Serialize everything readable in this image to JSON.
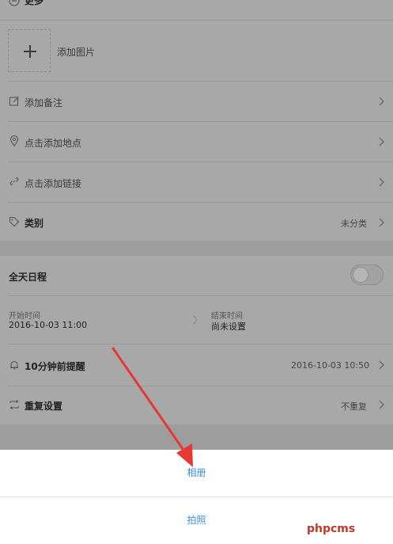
{
  "header": {
    "title": "更多"
  },
  "photo": {
    "label": "添加图片"
  },
  "items": {
    "note": "添加备注",
    "location": "点击添加地点",
    "link": "点击添加链接",
    "category_label": "类别",
    "category_value": "未分类"
  },
  "allday": {
    "label": "全天日程",
    "enabled": false
  },
  "time": {
    "start_label": "开始时间",
    "start_value": "2016-10-03 11:00",
    "end_label": "结束时间",
    "end_value": "尚未设置"
  },
  "reminder": {
    "label": "10分钟前提醒",
    "value": "2016-10-03 10:50"
  },
  "repeat": {
    "label": "重复设置",
    "value": "不重复"
  },
  "sheet": {
    "album": "相册",
    "camera": "拍照"
  },
  "watermark": "phpcms",
  "colors": {
    "accent": "#3a8fd6",
    "arrow": "#e53935",
    "overlay": "#a8a8a8"
  }
}
